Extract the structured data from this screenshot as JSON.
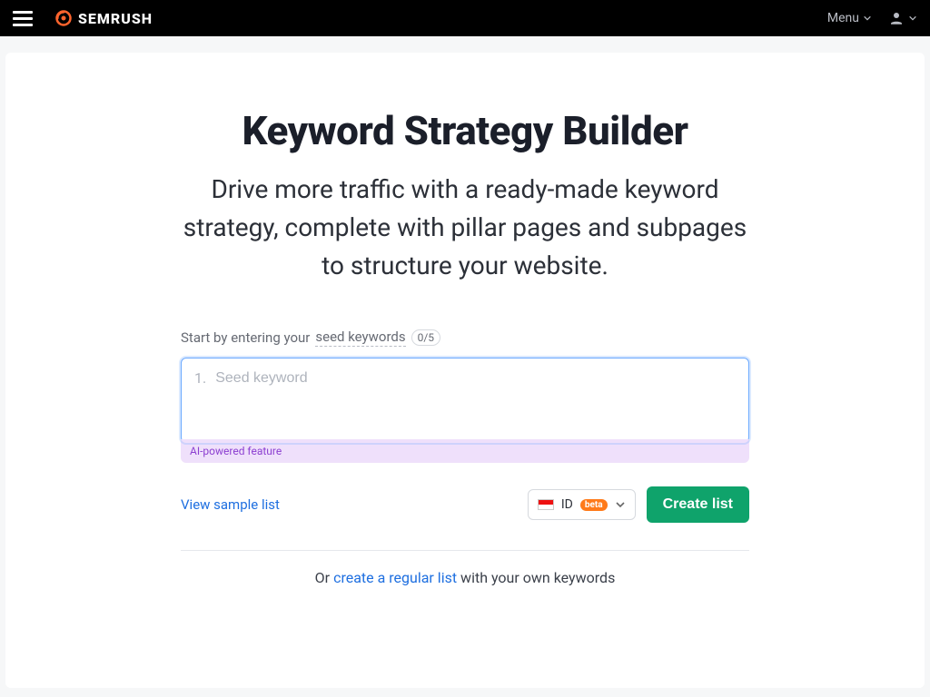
{
  "topbar": {
    "brand": "SEMRUSH",
    "menu_label": "Menu"
  },
  "page": {
    "title": "Keyword Strategy Builder",
    "subtitle": "Drive more traffic with a ready-made keyword strategy, complete with pillar pages and subpages to structure your website."
  },
  "form": {
    "label_prefix": "Start by entering your ",
    "label_seed": "seed keywords",
    "count": "0/5",
    "index": "1.",
    "placeholder": "Seed keyword",
    "ai_note": "AI-powered feature"
  },
  "actions": {
    "sample_link": "View sample list",
    "db_code": "ID",
    "db_badge": "beta",
    "create_label": "Create list"
  },
  "footer": {
    "or_prefix": "Or ",
    "regular_link": "create a regular list",
    "or_suffix": " with your own keywords"
  }
}
